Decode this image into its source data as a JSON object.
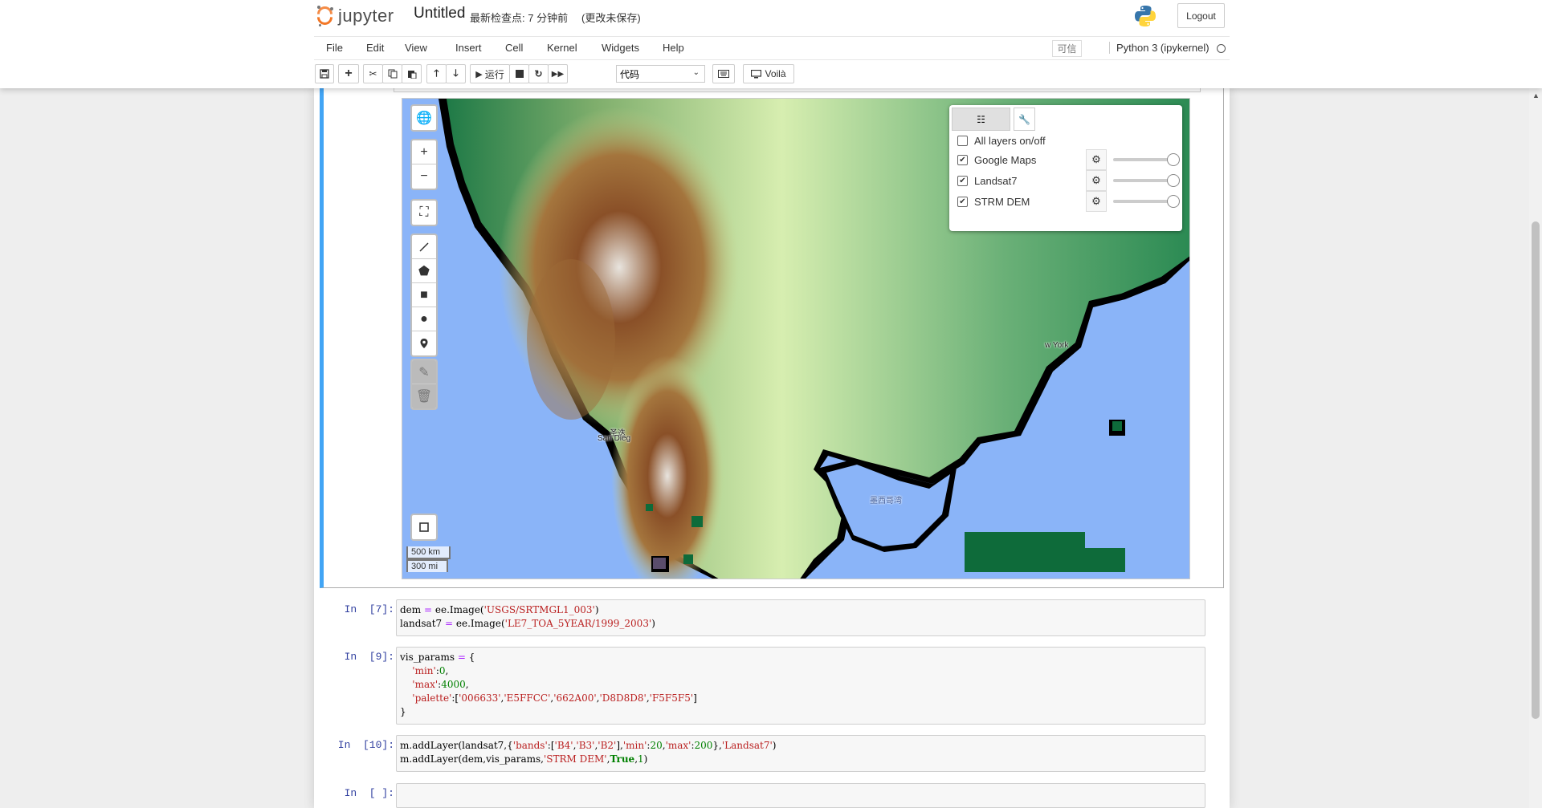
{
  "header": {
    "logo_text": "jupyter",
    "notebook_title": "Untitled",
    "checkpoint": "最新检查点: 7 分钟前",
    "unsaved": "(更改未保存)",
    "logout_label": "Logout"
  },
  "menubar": {
    "items": [
      "File",
      "Edit",
      "View",
      "Insert",
      "Cell",
      "Kernel",
      "Widgets",
      "Help"
    ],
    "trusted_label": "可信",
    "kernel_name": "Python 3 (ipykernel)"
  },
  "toolbar": {
    "run_label": "运行",
    "cell_type": "代码",
    "voila_label": "Voilà"
  },
  "map": {
    "scale_km": "500 km",
    "scale_mi": "300 mi",
    "labels": {
      "new_york": "w York",
      "san_diego_cn": "圣迭",
      "san_diego": "San Dieg",
      "gulf_of_mexico": "墨西哥湾"
    },
    "layer_panel": {
      "all_layers_label": "All layers on/off",
      "all_layers_checked": false,
      "layers": [
        {
          "name": "Google Maps",
          "checked": true,
          "opacity": 1.0
        },
        {
          "name": "Landsat7",
          "checked": true,
          "opacity": 1.0
        },
        {
          "name": "STRM DEM",
          "checked": true,
          "opacity": 1.0
        }
      ]
    },
    "colors": {
      "water": "#8ab4f8",
      "dem_low": "#006633",
      "dem_mid1": "#E5FFCC",
      "dem_mid2": "#662A00",
      "dem_high1": "#D8D8D8",
      "dem_high2": "#F5F5F5"
    }
  },
  "cells": [
    {
      "prompt": "In  [7]:",
      "lines": [
        "dem = ee.Image('USGS/SRTMGL1_003')",
        "landsat7 = ee.Image('LE7_TOA_5YEAR/1999_2003')"
      ]
    },
    {
      "prompt": "In  [9]:",
      "lines": [
        "vis_params = {",
        "    'min':0,",
        "    'max':4000,",
        "    'palette':['006633','E5FFCC','662A00','D8D8D8','F5F5F5']",
        "}"
      ]
    },
    {
      "prompt": "In  [10]:",
      "lines": [
        "m.addLayer(landsat7,{'bands':['B4','B3','B2'],'min':20,'max':200},'Landsat7')",
        "m.addLayer(dem,vis_params,'STRM DEM',True,1)"
      ]
    },
    {
      "prompt": "In  [ ]:",
      "lines": [
        ""
      ]
    }
  ]
}
